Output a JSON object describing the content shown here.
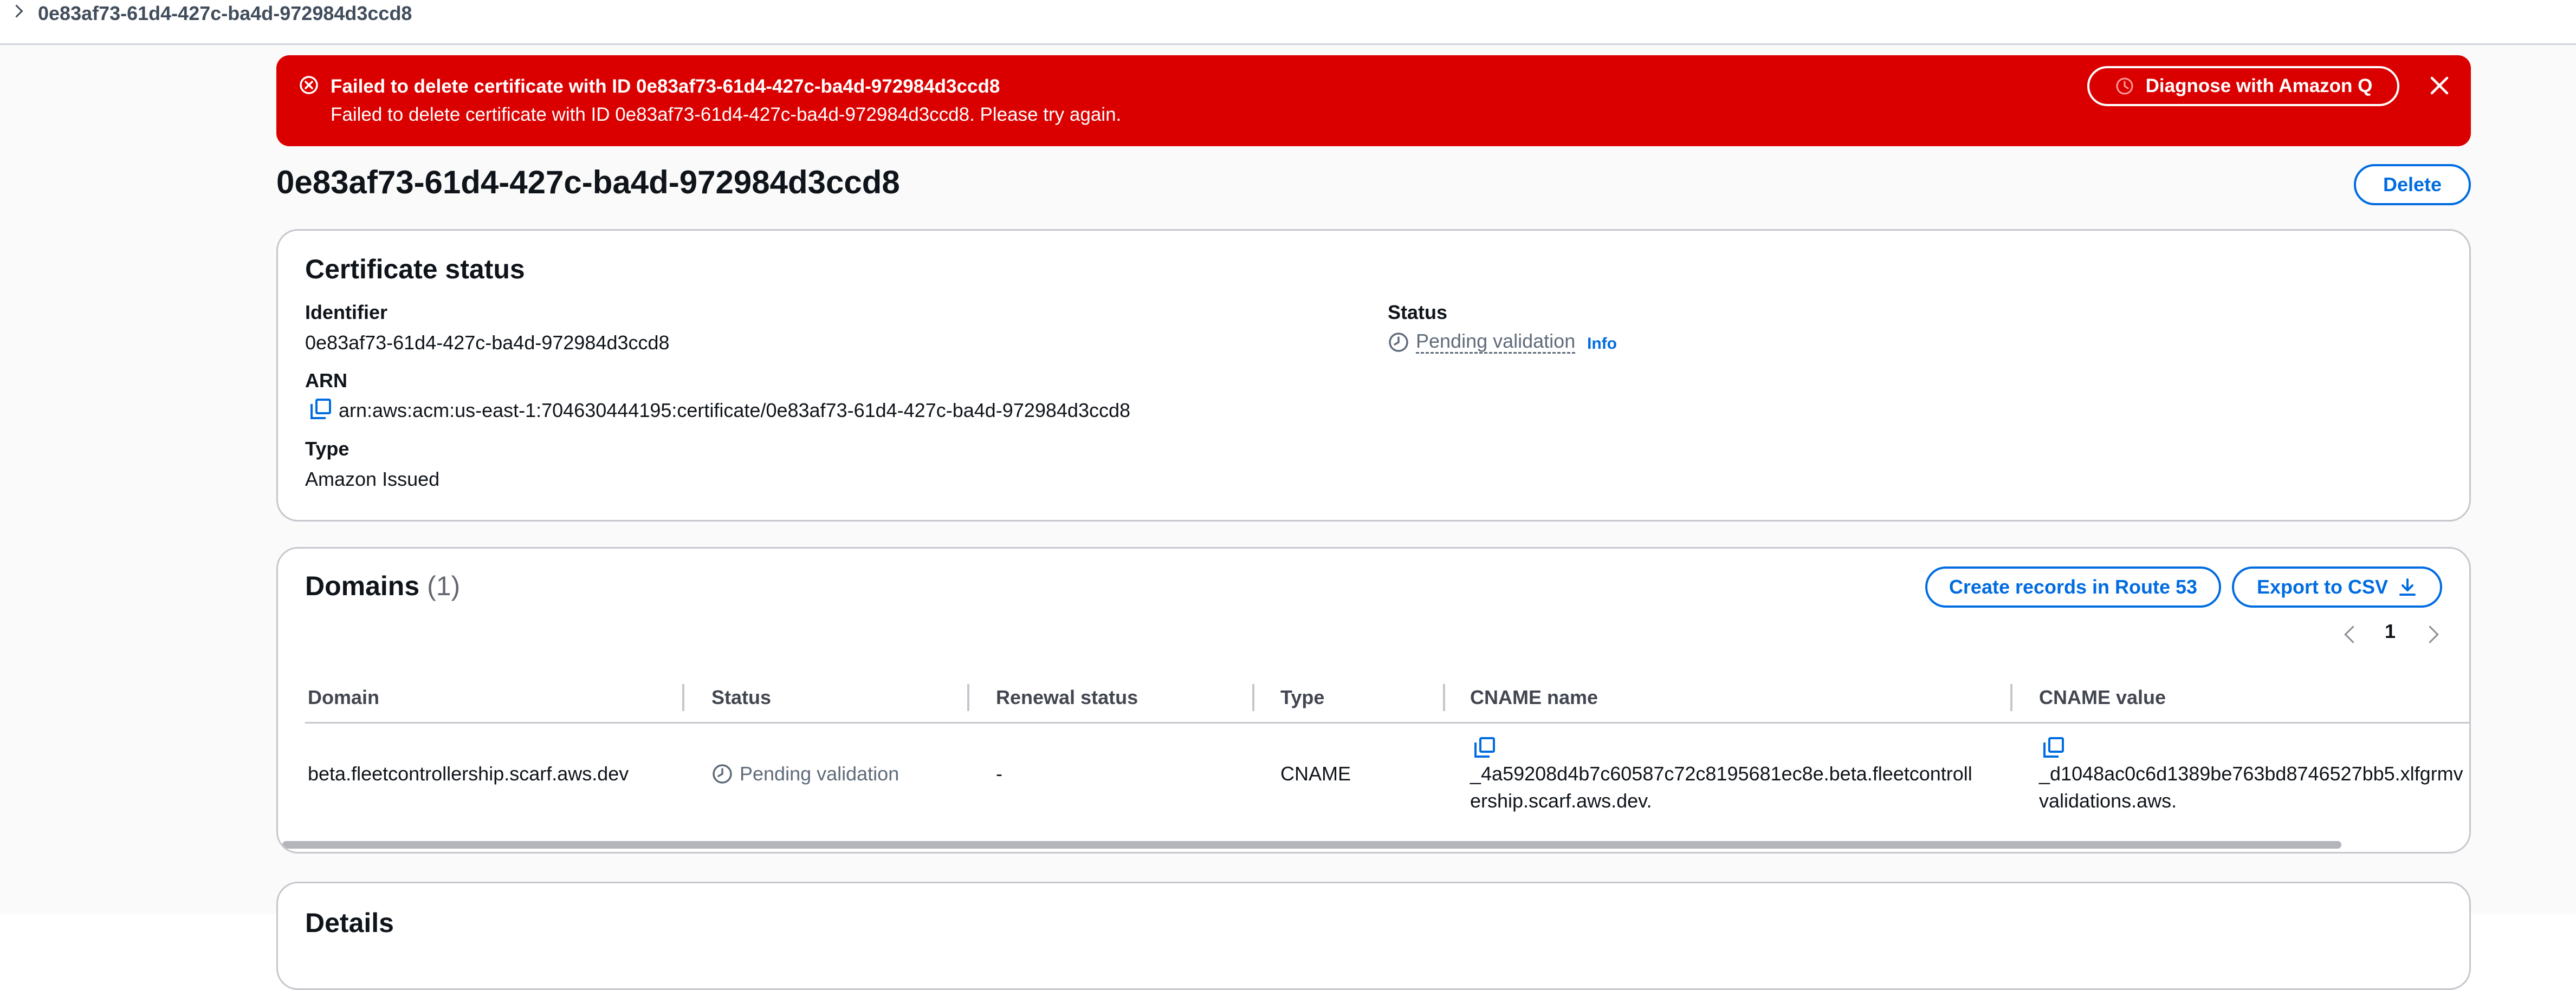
{
  "breadcrumb": {
    "current": "0e83af73-61d4-427c-ba4d-972984d3ccd8"
  },
  "flash": {
    "type": "error",
    "header": "Failed to delete certificate with ID 0e83af73-61d4-427c-ba4d-972984d3ccd8",
    "content": "Failed to delete certificate with ID 0e83af73-61d4-427c-ba4d-972984d3ccd8. Please try again.",
    "action_label": "Diagnose with Amazon Q",
    "background_color": "#db0000"
  },
  "page": {
    "title": "0e83af73-61d4-427c-ba4d-972984d3ccd8",
    "delete_label": "Delete"
  },
  "certificate_status": {
    "heading": "Certificate status",
    "identifier_label": "Identifier",
    "identifier_value": "0e83af73-61d4-427c-ba4d-972984d3ccd8",
    "arn_label": "ARN",
    "arn_value": "arn:aws:acm:us-east-1:704630444195:certificate/0e83af73-61d4-427c-ba4d-972984d3ccd8",
    "type_label": "Type",
    "type_value": "Amazon Issued",
    "status_label": "Status",
    "status_value": "Pending validation",
    "info_label": "Info"
  },
  "domains": {
    "heading": "Domains",
    "count": "(1)",
    "create_records_label": "Create records in Route 53",
    "export_label": "Export to CSV",
    "pagination": {
      "current_page": "1"
    },
    "columns": [
      "Domain",
      "Status",
      "Renewal status",
      "Type",
      "CNAME name",
      "CNAME value"
    ],
    "rows": [
      {
        "domain": "beta.fleetcontrollership.scarf.aws.dev",
        "status": "Pending validation",
        "renewal_status": "-",
        "type": "CNAME",
        "cname_name_line1": "_4a59208d4b7c60587c72c8195681ec8e.beta.fleetcontroll",
        "cname_name_line2": "ership.scarf.aws.dev.",
        "cname_value_line1": "_d1048ac0c6d1389be763bd8746527bb5.xlfgrmv",
        "cname_value_line2": "validations.aws."
      }
    ]
  },
  "details": {
    "heading": "Details"
  },
  "colors": {
    "accent": "#006ce0",
    "error": "#db0000",
    "muted": "#5f6b7a"
  }
}
